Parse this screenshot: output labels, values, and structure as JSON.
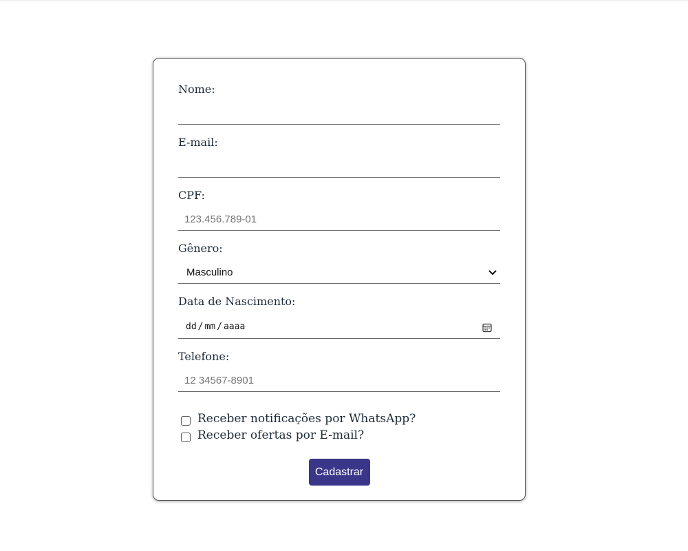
{
  "form": {
    "name": {
      "label": "Nome:",
      "value": "",
      "placeholder": ""
    },
    "email": {
      "label": "E-mail:",
      "value": "",
      "placeholder": ""
    },
    "cpf": {
      "label": "CPF:",
      "value": "",
      "placeholder": "123.456.789-01"
    },
    "gender": {
      "label": "Gênero:",
      "selected": "Masculino"
    },
    "birthdate": {
      "label": "Data de Nascimento:",
      "day": "dd",
      "month": "mm",
      "year": "aaaa",
      "separator": "/"
    },
    "phone": {
      "label": "Telefone:",
      "value": "",
      "placeholder": "12 34567-8901"
    },
    "checkboxes": [
      {
        "label": "Receber notificações por WhatsApp?",
        "checked": false
      },
      {
        "label": "Receber ofertas por E-mail?",
        "checked": false
      }
    ],
    "submit_label": "Cadastrar"
  },
  "colors": {
    "button": "#3a378a",
    "label": "#1e2b3a",
    "underline": "#6b6b6b"
  },
  "icons": {
    "select": "chevron-down-icon",
    "date": "calendar-icon"
  }
}
